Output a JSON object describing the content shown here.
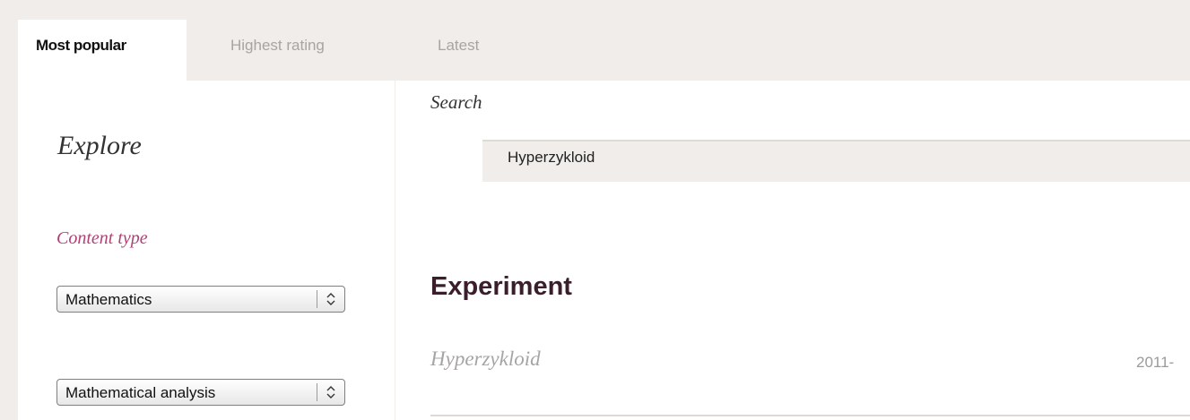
{
  "tabs": [
    {
      "label": "Most popular",
      "active": true
    },
    {
      "label": "Highest rating",
      "active": false
    },
    {
      "label": "Latest",
      "active": false
    }
  ],
  "sidebar": {
    "title": "Explore",
    "content_type_label": "Content type",
    "selects": [
      {
        "value": "Mathematics"
      },
      {
        "value": "Mathematical analysis"
      }
    ]
  },
  "main": {
    "search_label": "Search",
    "search_value": "Hyperzykloid",
    "section_heading": "Experiment",
    "results": [
      {
        "title": "Hyperzykloid",
        "date": "2011-"
      }
    ]
  },
  "colors": {
    "page_background": "#f0edea",
    "accent_label": "#b13f74",
    "heading": "#3a1e2c",
    "muted_text": "#a7a5a3"
  },
  "icons": {
    "select_arrows": "chevron-up-down-icon"
  }
}
